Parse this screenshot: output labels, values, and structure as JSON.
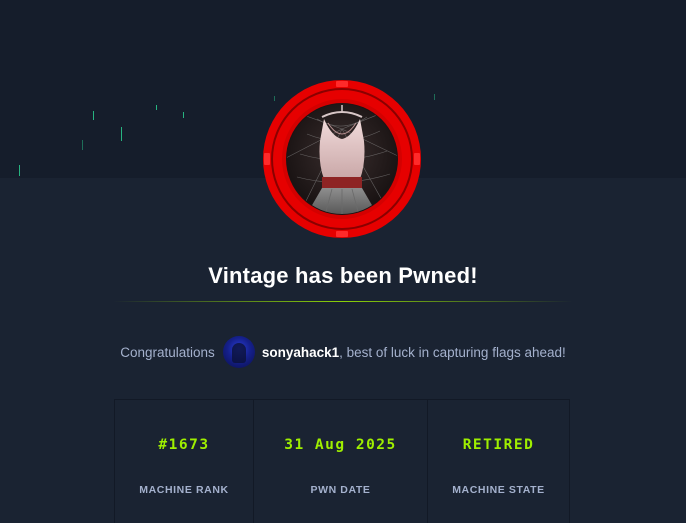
{
  "machine": {
    "name": "Vintage",
    "title": "Vintage has been Pwned!",
    "badge_icon": "vintage-dress-machine-icon"
  },
  "congrats": {
    "prefix": "Congratulations",
    "username": "sonyahack1",
    "suffix": ", best of luck in capturing flags ahead!",
    "avatar_icon": "hooded-figure-avatar"
  },
  "stats": [
    {
      "value": "#1673",
      "label": "MACHINE RANK"
    },
    {
      "value": "31 Aug 2025",
      "label": "PWN DATE"
    },
    {
      "value": "RETIRED",
      "label": "MACHINE STATE"
    }
  ],
  "colors": {
    "background": "#1a2332",
    "hero_background": "#151d2b",
    "accent_green": "#9fef00",
    "badge_ring_red": "#e60000",
    "muted_text": "#a4b1cd",
    "title_text": "#ffffff"
  }
}
